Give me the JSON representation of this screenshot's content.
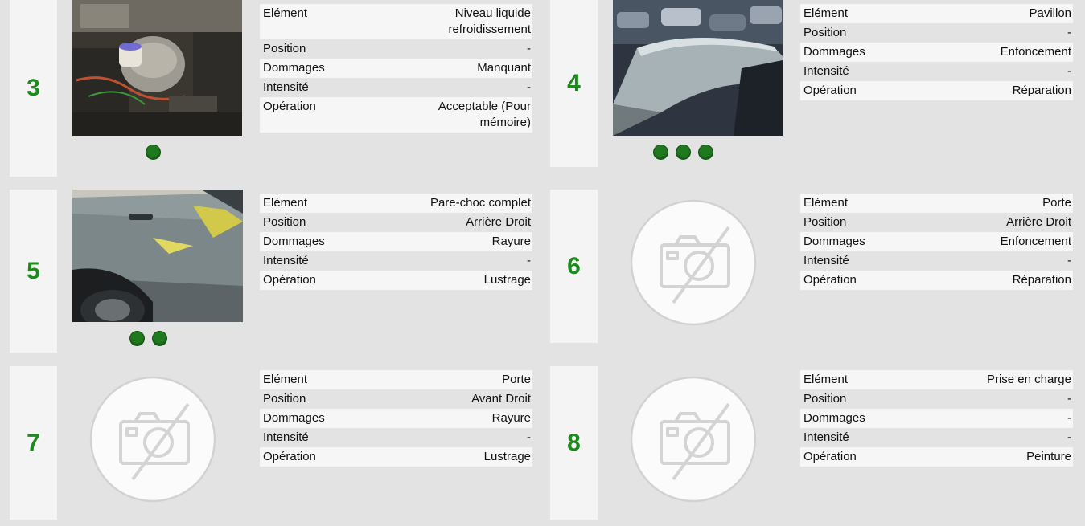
{
  "labels": {
    "element": "Elément",
    "position": "Position",
    "dommages": "Dommages",
    "intensite": "Intensité",
    "operation": "Opération"
  },
  "cards": [
    {
      "number": "3",
      "photo": "engine-bay-photo",
      "photo_dots": 1,
      "values": {
        "element": "Niveau liquide refroidissement",
        "position": "-",
        "dommages": "Manquant",
        "intensite": "-",
        "operation": "Acceptable (Pour mémoire)"
      }
    },
    {
      "number": "4",
      "photo": "car-roof-photo",
      "photo_dots": 3,
      "values": {
        "element": "Pavillon",
        "position": "-",
        "dommages": "Enfoncement",
        "intensite": "-",
        "operation": "Réparation"
      }
    },
    {
      "number": "5",
      "photo": "car-side-door-photo",
      "photo_dots": 2,
      "values": {
        "element": "Pare-choc complet",
        "position": "Arrière Droit",
        "dommages": "Rayure",
        "intensite": "-",
        "operation": "Lustrage"
      }
    },
    {
      "number": "6",
      "photo": "no-photo-icon",
      "photo_dots": 0,
      "values": {
        "element": "Porte",
        "position": "Arrière Droit",
        "dommages": "Enfoncement",
        "intensite": "-",
        "operation": "Réparation"
      }
    },
    {
      "number": "7",
      "photo": "no-photo-icon",
      "photo_dots": 0,
      "values": {
        "element": "Porte",
        "position": "Avant Droit",
        "dommages": "Rayure",
        "intensite": "-",
        "operation": "Lustrage"
      }
    },
    {
      "number": "8",
      "photo": "no-photo-icon",
      "photo_dots": 0,
      "values": {
        "element": "Prise en charge",
        "position": "-",
        "dommages": "-",
        "intensite": "-",
        "operation": "Peinture"
      }
    }
  ],
  "colors": {
    "number_green": "#1e8a1e",
    "dot_green": "#1f7a1f",
    "page_bg": "#e3e3e3",
    "row_light": "#f6f6f6"
  }
}
